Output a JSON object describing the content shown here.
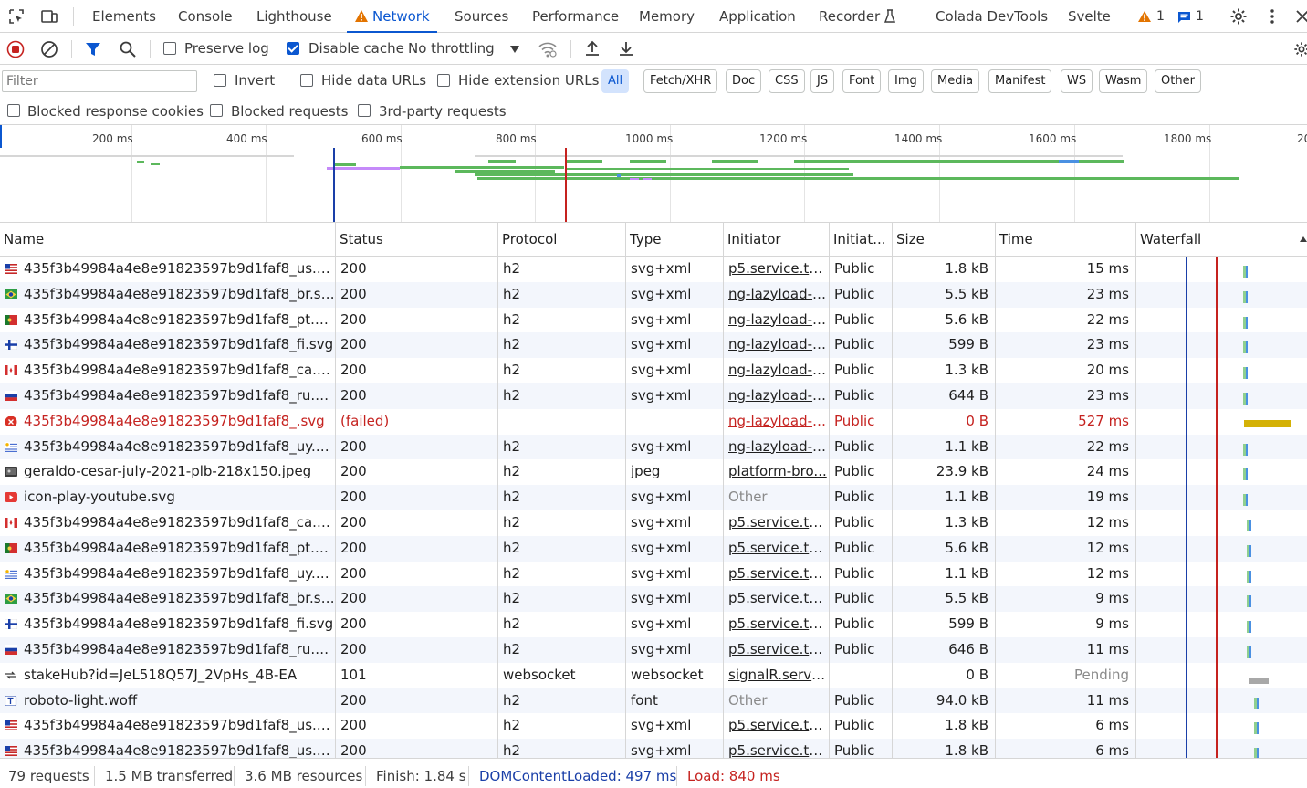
{
  "tabs": {
    "elements": "Elements",
    "console": "Console",
    "lighthouse": "Lighthouse",
    "network": "Network",
    "sources": "Sources",
    "performance": "Performance",
    "memory": "Memory",
    "application": "Application",
    "recorder": "Recorder",
    "colada": "Colada DevTools",
    "svelte": "Svelte"
  },
  "badges": {
    "warnings": "1",
    "messages": "1"
  },
  "toolbar": {
    "preserve_log": "Preserve log",
    "disable_cache": "Disable cache",
    "throttling": "No throttling"
  },
  "filter": {
    "placeholder": "Filter",
    "invert": "Invert",
    "hide_data_urls": "Hide data URLs",
    "hide_extension_urls": "Hide extension URLs",
    "types": [
      "All",
      "Fetch/XHR",
      "Doc",
      "CSS",
      "JS",
      "Font",
      "Img",
      "Media",
      "Manifest",
      "WS",
      "Wasm",
      "Other"
    ]
  },
  "options": {
    "blocked_cookies": "Blocked response cookies",
    "blocked_requests": "Blocked requests",
    "third_party": "3rd-party requests"
  },
  "overview": {
    "ticks": [
      "200 ms",
      "400 ms",
      "600 ms",
      "800 ms",
      "1000 ms",
      "1200 ms",
      "1400 ms",
      "1600 ms",
      "1800 ms",
      "20"
    ]
  },
  "columns": {
    "name": "Name",
    "status": "Status",
    "protocol": "Protocol",
    "type": "Type",
    "initiator": "Initiator",
    "initiator_address_space": "Initiat...",
    "size": "Size",
    "time": "Time",
    "waterfall": "Waterfall"
  },
  "rows": [
    {
      "flag": "us",
      "name": "435f3b49984a4e8e91823597b9d1faf8_us.svg",
      "status": "200",
      "protocol": "h2",
      "type": "svg+xml",
      "initiator": "p5.service.ts:30",
      "space": "Public",
      "size": "1.8 kB",
      "time": "15 ms"
    },
    {
      "flag": "br",
      "name": "435f3b49984a4e8e91823597b9d1faf8_br.svg",
      "status": "200",
      "protocol": "h2",
      "type": "svg+xml",
      "initiator": "ng-lazyload-i...",
      "space": "Public",
      "size": "5.5 kB",
      "time": "23 ms"
    },
    {
      "flag": "pt",
      "name": "435f3b49984a4e8e91823597b9d1faf8_pt.svg",
      "status": "200",
      "protocol": "h2",
      "type": "svg+xml",
      "initiator": "ng-lazyload-i...",
      "space": "Public",
      "size": "5.6 kB",
      "time": "22 ms"
    },
    {
      "flag": "fi",
      "name": "435f3b49984a4e8e91823597b9d1faf8_fi.svg",
      "status": "200",
      "protocol": "h2",
      "type": "svg+xml",
      "initiator": "ng-lazyload-i...",
      "space": "Public",
      "size": "599 B",
      "time": "23 ms"
    },
    {
      "flag": "ca",
      "name": "435f3b49984a4e8e91823597b9d1faf8_ca.svg",
      "status": "200",
      "protocol": "h2",
      "type": "svg+xml",
      "initiator": "ng-lazyload-i...",
      "space": "Public",
      "size": "1.3 kB",
      "time": "20 ms"
    },
    {
      "flag": "ru",
      "name": "435f3b49984a4e8e91823597b9d1faf8_ru.svg",
      "status": "200",
      "protocol": "h2",
      "type": "svg+xml",
      "initiator": "ng-lazyload-i...",
      "space": "Public",
      "size": "644 B",
      "time": "23 ms"
    },
    {
      "flag": "error",
      "name": "435f3b49984a4e8e91823597b9d1faf8_.svg",
      "status": "(failed)",
      "protocol": "",
      "type": "",
      "initiator": "ng-lazyload-i...",
      "space": "Public",
      "size": "0 B",
      "time": "527 ms",
      "failed": true
    },
    {
      "flag": "uy",
      "name": "435f3b49984a4e8e91823597b9d1faf8_uy.svg",
      "status": "200",
      "protocol": "h2",
      "type": "svg+xml",
      "initiator": "ng-lazyload-i...",
      "space": "Public",
      "size": "1.1 kB",
      "time": "22 ms"
    },
    {
      "flag": "img",
      "name": "geraldo-cesar-july-2021-plb-218x150.jpeg",
      "status": "200",
      "protocol": "h2",
      "type": "jpeg",
      "initiator": "platform-bro...",
      "space": "Public",
      "size": "23.9 kB",
      "time": "24 ms"
    },
    {
      "flag": "yt",
      "name": "icon-play-youtube.svg",
      "status": "200",
      "protocol": "h2",
      "type": "svg+xml",
      "initiator": "Other",
      "space": "Public",
      "size": "1.1 kB",
      "time": "19 ms",
      "initiator_plain": true
    },
    {
      "flag": "ca",
      "name": "435f3b49984a4e8e91823597b9d1faf8_ca.svg",
      "status": "200",
      "protocol": "h2",
      "type": "svg+xml",
      "initiator": "p5.service.ts:30",
      "space": "Public",
      "size": "1.3 kB",
      "time": "12 ms"
    },
    {
      "flag": "pt",
      "name": "435f3b49984a4e8e91823597b9d1faf8_pt.svg",
      "status": "200",
      "protocol": "h2",
      "type": "svg+xml",
      "initiator": "p5.service.ts:30",
      "space": "Public",
      "size": "5.6 kB",
      "time": "12 ms"
    },
    {
      "flag": "uy",
      "name": "435f3b49984a4e8e91823597b9d1faf8_uy.svg",
      "status": "200",
      "protocol": "h2",
      "type": "svg+xml",
      "initiator": "p5.service.ts:30",
      "space": "Public",
      "size": "1.1 kB",
      "time": "12 ms"
    },
    {
      "flag": "br",
      "name": "435f3b49984a4e8e91823597b9d1faf8_br.svg",
      "status": "200",
      "protocol": "h2",
      "type": "svg+xml",
      "initiator": "p5.service.ts:30",
      "space": "Public",
      "size": "5.5 kB",
      "time": "9 ms"
    },
    {
      "flag": "fi",
      "name": "435f3b49984a4e8e91823597b9d1faf8_fi.svg",
      "status": "200",
      "protocol": "h2",
      "type": "svg+xml",
      "initiator": "p5.service.ts:30",
      "space": "Public",
      "size": "599 B",
      "time": "9 ms"
    },
    {
      "flag": "ru",
      "name": "435f3b49984a4e8e91823597b9d1faf8_ru.svg",
      "status": "200",
      "protocol": "h2",
      "type": "svg+xml",
      "initiator": "p5.service.ts:30",
      "space": "Public",
      "size": "646 B",
      "time": "11 ms"
    },
    {
      "flag": "ws",
      "name": "stakeHub?id=JeL518Q57J_2VpHs_4B-EA",
      "status": "101",
      "protocol": "websocket",
      "type": "websocket",
      "initiator": "signalR.servic...",
      "space": "",
      "size": "0 B",
      "time": "Pending",
      "pending": true
    },
    {
      "flag": "font",
      "name": "roboto-light.woff",
      "status": "200",
      "protocol": "h2",
      "type": "font",
      "initiator": "Other",
      "space": "Public",
      "size": "94.0 kB",
      "time": "11 ms",
      "initiator_plain": true
    },
    {
      "flag": "us",
      "name": "435f3b49984a4e8e91823597b9d1faf8_us.svg",
      "status": "200",
      "protocol": "h2",
      "type": "svg+xml",
      "initiator": "p5.service.ts:40",
      "space": "Public",
      "size": "1.8 kB",
      "time": "6 ms"
    },
    {
      "flag": "us",
      "name": "435f3b49984a4e8e91823597b9d1faf8_us.svg",
      "status": "200",
      "protocol": "h2",
      "type": "svg+xml",
      "initiator": "p5.service.ts:30",
      "space": "Public",
      "size": "1.8 kB",
      "time": "6 ms"
    }
  ],
  "statusbar": {
    "requests": "79 requests",
    "transferred": "1.5 MB transferred",
    "resources": "3.6 MB resources",
    "finish": "Finish: 1.84 s",
    "dcl": "DOMContentLoaded: 497 ms",
    "load": "Load: 840 ms"
  },
  "colors": {
    "accent": "#0b57d0",
    "error": "#c5221f",
    "dcl_line": "#1a3fa8",
    "load_line": "#c5221f",
    "waterfall_green": "#5cb85c",
    "waterfall_failed": "#d4b106"
  }
}
